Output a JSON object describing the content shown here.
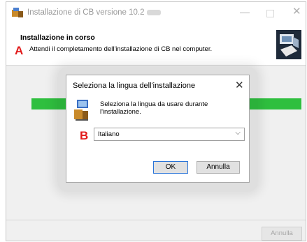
{
  "window": {
    "title": "Installazione di CB versione 10.2",
    "minimize_glyph": "—",
    "close_glyph": "✕"
  },
  "header": {
    "title": "Installazione in corso",
    "subtitle": "Attendi il completamento dell'installazione di CB nel computer."
  },
  "markers": {
    "a": "A",
    "b": "B"
  },
  "progress": {
    "value": 1.0,
    "color": "#2fbf3f"
  },
  "footer": {
    "cancel_label": "Annulla"
  },
  "dialog": {
    "title": "Seleziona la lingua dell'installazione",
    "close_glyph": "✕",
    "message": "Seleziona la lingua da usare durante l'installazione.",
    "language_select": {
      "value": "Italiano",
      "chevron": "⌵"
    },
    "ok_label": "OK",
    "cancel_label": "Annulla"
  },
  "icons": [
    "installer-icon",
    "installer-logo-icon",
    "setup-computer-icon",
    "chevron-down-icon",
    "close-icon"
  ],
  "colors": {
    "marker": "#e21b1b",
    "ok_border": "#2a74d8"
  }
}
